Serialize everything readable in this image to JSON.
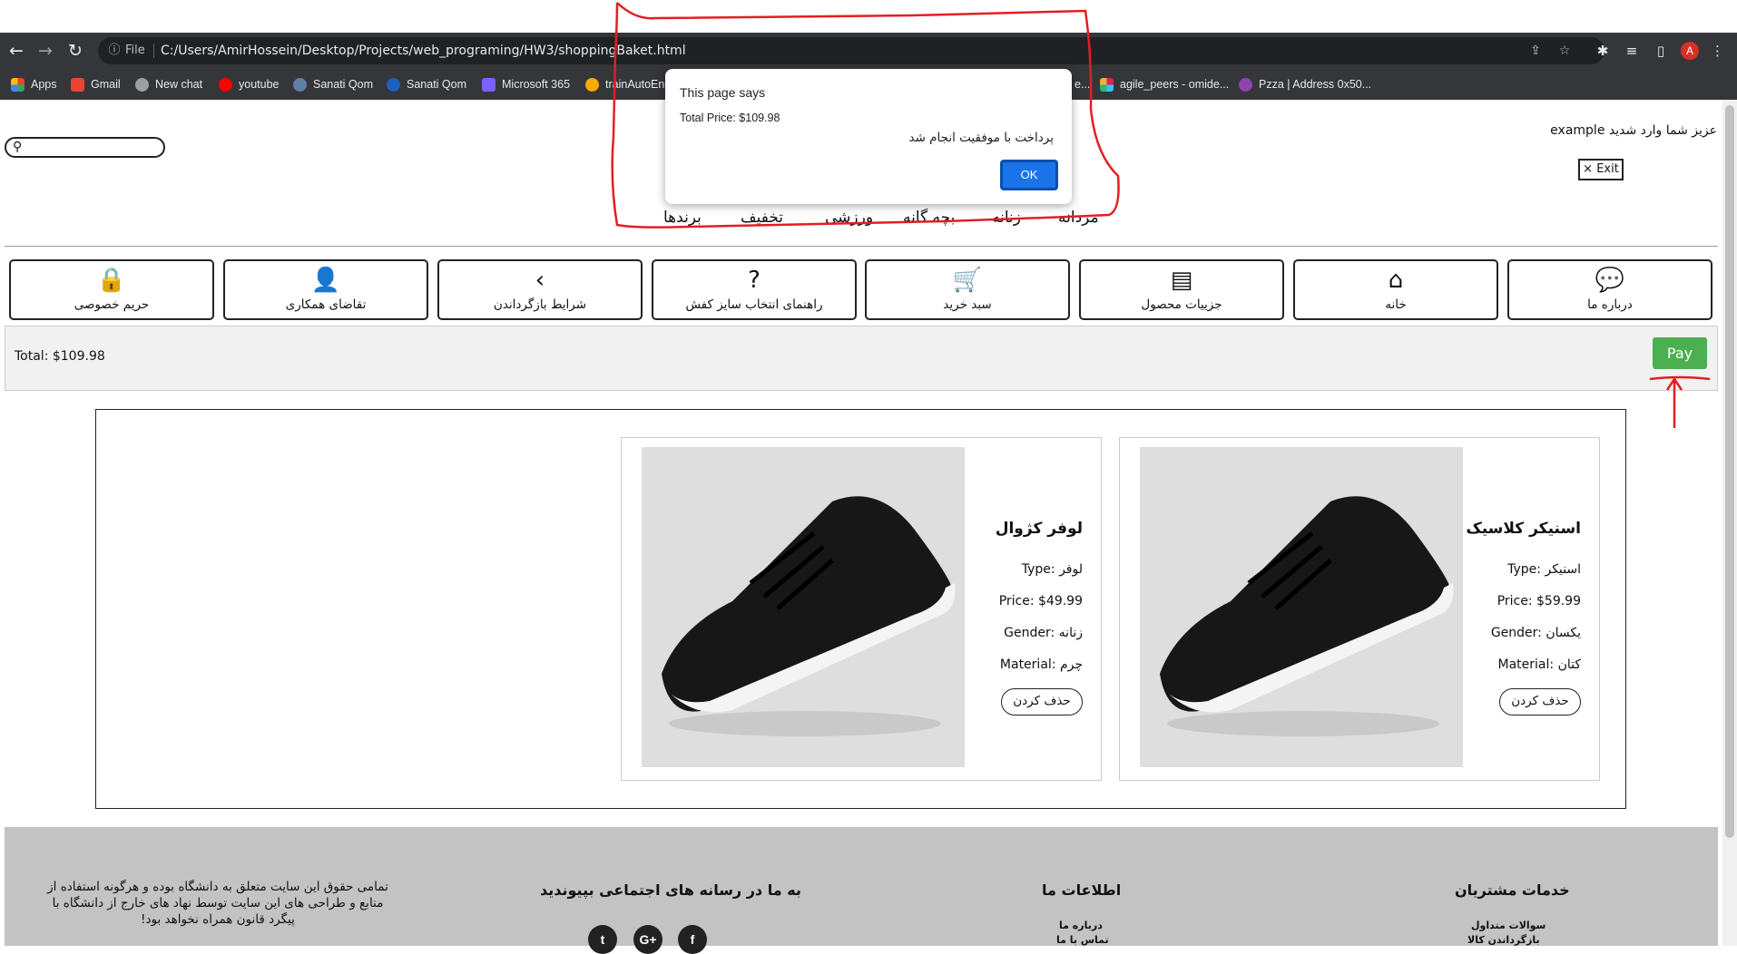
{
  "browser": {
    "address_scheme": "File",
    "url": "C:/Users/AmirHossein/Desktop/Projects/web_programing/HW3/shoppingBaket.html",
    "avatar_letter": "A",
    "bookmarks": [
      "Apps",
      "Gmail",
      "New chat",
      "youtube",
      "Sanati Qom",
      "Sanati Qom",
      "Microsoft 365",
      "trainAutoEnc",
      "e...",
      "agile_peers - omide...",
      "Pzza | Address 0x50..."
    ]
  },
  "header": {
    "greeting": "عزیز شما وارد شدید example",
    "exit_label": "× Exit",
    "categories": [
      "مردانه",
      "زنانه",
      "بچه گانه",
      "ورزشی",
      "تخفیف",
      "برندها"
    ]
  },
  "nav": {
    "items": [
      {
        "label": "درباره ما",
        "icon": "chat-icon"
      },
      {
        "label": "خانه",
        "icon": "home-icon"
      },
      {
        "label": "جزییات محصول",
        "icon": "document-icon"
      },
      {
        "label": "سبد خرید",
        "icon": "cart-icon"
      },
      {
        "label": "راهنمای انتخاب سایز کفش",
        "icon": "question-icon"
      },
      {
        "label": "شرایط بازگرداندن",
        "icon": "chevron-left-icon"
      },
      {
        "label": "تقاضای همکاری",
        "icon": "person-icon"
      },
      {
        "label": "حریم خصوصی",
        "icon": "lock-icon"
      }
    ]
  },
  "cart": {
    "total_text": "Total: $109.98",
    "pay_label": "Pay",
    "products": [
      {
        "name": "اسنیکر کلاسیک",
        "type": "Type: اسنیکر",
        "price": "Price: $59.99",
        "gender": "Gender: یکسان",
        "material": "Material: کتان",
        "remove_label": "حذف کردن"
      },
      {
        "name": "لوفر کژوال",
        "type": "Type: لوفر",
        "price": "Price: $49.99",
        "gender": "Gender: زنانه",
        "material": "Material: چرم",
        "remove_label": "حذف کردن"
      }
    ]
  },
  "footer": {
    "customer_service": {
      "title": "خدمات مشتریان",
      "links": [
        "سوالات متداول",
        "بازگرداندن کالا"
      ]
    },
    "our_info": {
      "title": "اطلاعات ما",
      "links": [
        "درباره ما",
        "تماس با ما"
      ]
    },
    "social": {
      "title": "به ما در رسانه های اجتماعی بپیوندید",
      "icons": [
        "twitter-icon",
        "google-plus-icon",
        "facebook-icon"
      ]
    },
    "copyright": "تمامی حقوق این سایت متعلق به دانشگاه بوده و هرگونه استفاده از منابع و طراحی های این سایت توسط نهاد های خارج از دانشگاه با پیگرد قانون همراه نخواهد بود!"
  },
  "dialog": {
    "title": "This page says",
    "price_text": "Total Price: $109.98",
    "message": "پرداخت با موفقیت انجام شد",
    "ok_label": "OK"
  },
  "colors": {
    "pay_button": "#4caf50",
    "ok_button": "#1a73e8",
    "annotation": "#e31e24",
    "footer_bg": "#c3c3c3"
  }
}
